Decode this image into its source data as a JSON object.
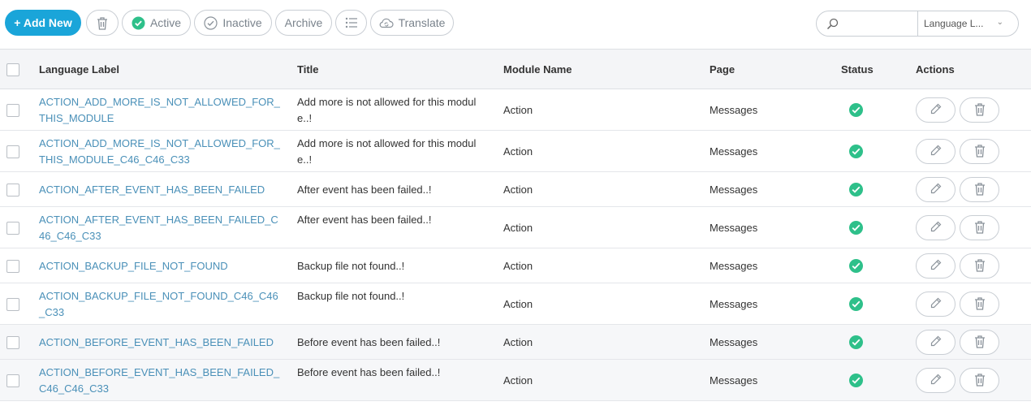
{
  "toolbar": {
    "add_new": "+ Add New",
    "active": "Active",
    "inactive": "Inactive",
    "archive": "Archive",
    "translate": "Translate"
  },
  "search": {
    "value": "",
    "select_value": "Language L...",
    "icon": "search-icon"
  },
  "colors": {
    "primary": "#1aa5d9",
    "status_active": "#2ec08a",
    "link": "#4a90b8"
  },
  "table": {
    "headers": {
      "label": "Language Label",
      "title": "Title",
      "module": "Module Name",
      "page": "Page",
      "status": "Status",
      "actions": "Actions"
    },
    "rows": [
      {
        "label_l1": "ACTION_ADD_MORE_IS_NOT_ALLOWED_FOR_",
        "label_l2": "THIS_MODULE",
        "title_l1": "Add more is not allowed for this modul",
        "title_l2": "e..!",
        "module": "Action",
        "page": "Messages",
        "status": "active"
      },
      {
        "label_l1": "ACTION_ADD_MORE_IS_NOT_ALLOWED_FOR_",
        "label_l2": "THIS_MODULE_C46_C46_C33",
        "title_l1": "Add more is not allowed for this modul",
        "title_l2": "e..!",
        "module": "Action",
        "page": "Messages",
        "status": "active"
      },
      {
        "label_l1": "ACTION_AFTER_EVENT_HAS_BEEN_FAILED",
        "label_l2": "",
        "title_l1": "After event has been failed..!",
        "title_l2": "",
        "module": "Action",
        "page": "Messages",
        "status": "active"
      },
      {
        "label_l1": "ACTION_AFTER_EVENT_HAS_BEEN_FAILED_C",
        "label_l2": "46_C46_C33",
        "title_l1": "After event has been failed..!",
        "title_l2": "",
        "module": "Action",
        "page": "Messages",
        "status": "active"
      },
      {
        "label_l1": "ACTION_BACKUP_FILE_NOT_FOUND",
        "label_l2": "",
        "title_l1": "Backup file not found..!",
        "title_l2": "",
        "module": "Action",
        "page": "Messages",
        "status": "active"
      },
      {
        "label_l1": "ACTION_BACKUP_FILE_NOT_FOUND_C46_C46",
        "label_l2": "_C33",
        "title_l1": "Backup file not found..!",
        "title_l2": "",
        "module": "Action",
        "page": "Messages",
        "status": "active"
      },
      {
        "label_l1": "ACTION_BEFORE_EVENT_HAS_BEEN_FAILED",
        "label_l2": "",
        "title_l1": "Before event has been failed..!",
        "title_l2": "",
        "module": "Action",
        "page": "Messages",
        "status": "active"
      },
      {
        "label_l1": "ACTION_BEFORE_EVENT_HAS_BEEN_FAILED_",
        "label_l2": "C46_C46_C33",
        "title_l1": "Before event has been failed..!",
        "title_l2": "",
        "module": "Action",
        "page": "Messages",
        "status": "active"
      }
    ]
  }
}
